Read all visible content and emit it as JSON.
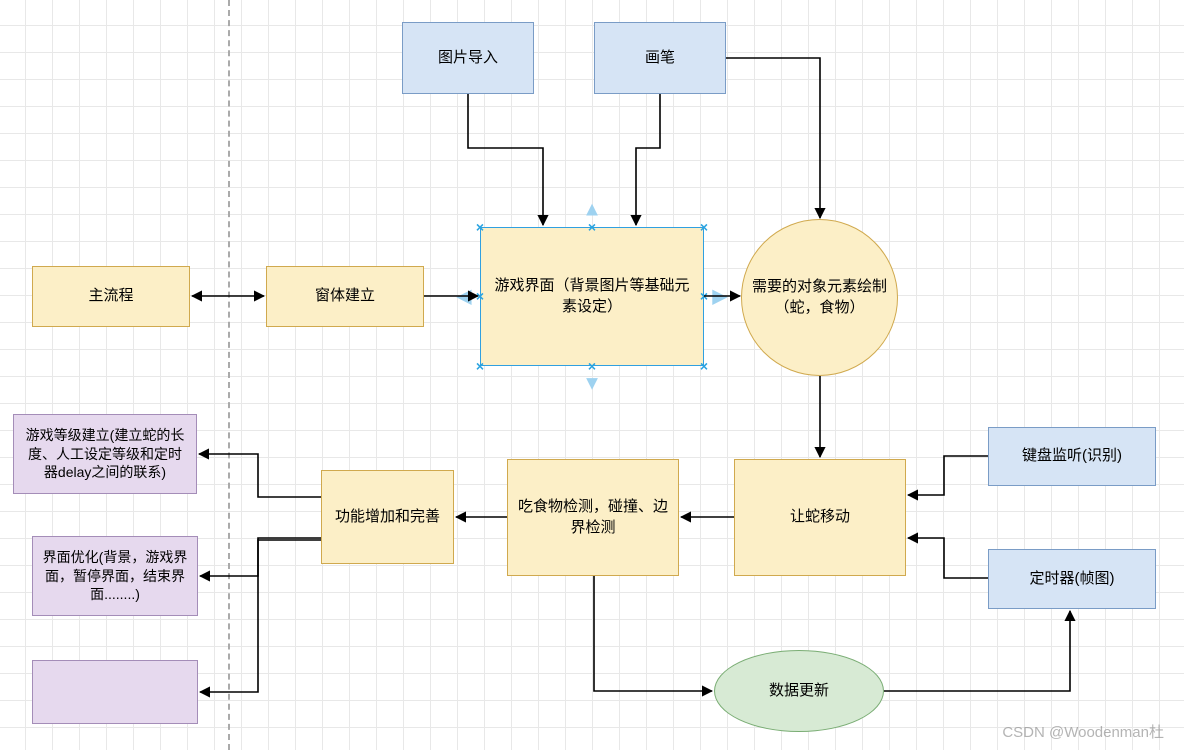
{
  "nodes": {
    "main_flow": "主流程",
    "window_create": "窗体建立",
    "game_ui": "游戏界面（背景图片等基础元素设定）",
    "elements_draw": "需要的对象元素绘制（蛇，食物）",
    "image_import": "图片导入",
    "brush": "画笔",
    "feature_enhance": "功能增加和完善",
    "collision": "吃食物检测，碰撞、边界检测",
    "snake_move": "让蛇移动",
    "keyboard": "键盘监听(识别)",
    "timer": "定时器(帧图)",
    "data_update": "数据更新",
    "level_setup": "游戏等级建立(建立蛇的长度、人工设定等级和定时器delay之间的联系)",
    "ui_optimize": "界面优化(背景，游戏界面，暂停界面，结束界面........)",
    "blank": ""
  },
  "watermark": "CSDN @Woodenman杜"
}
